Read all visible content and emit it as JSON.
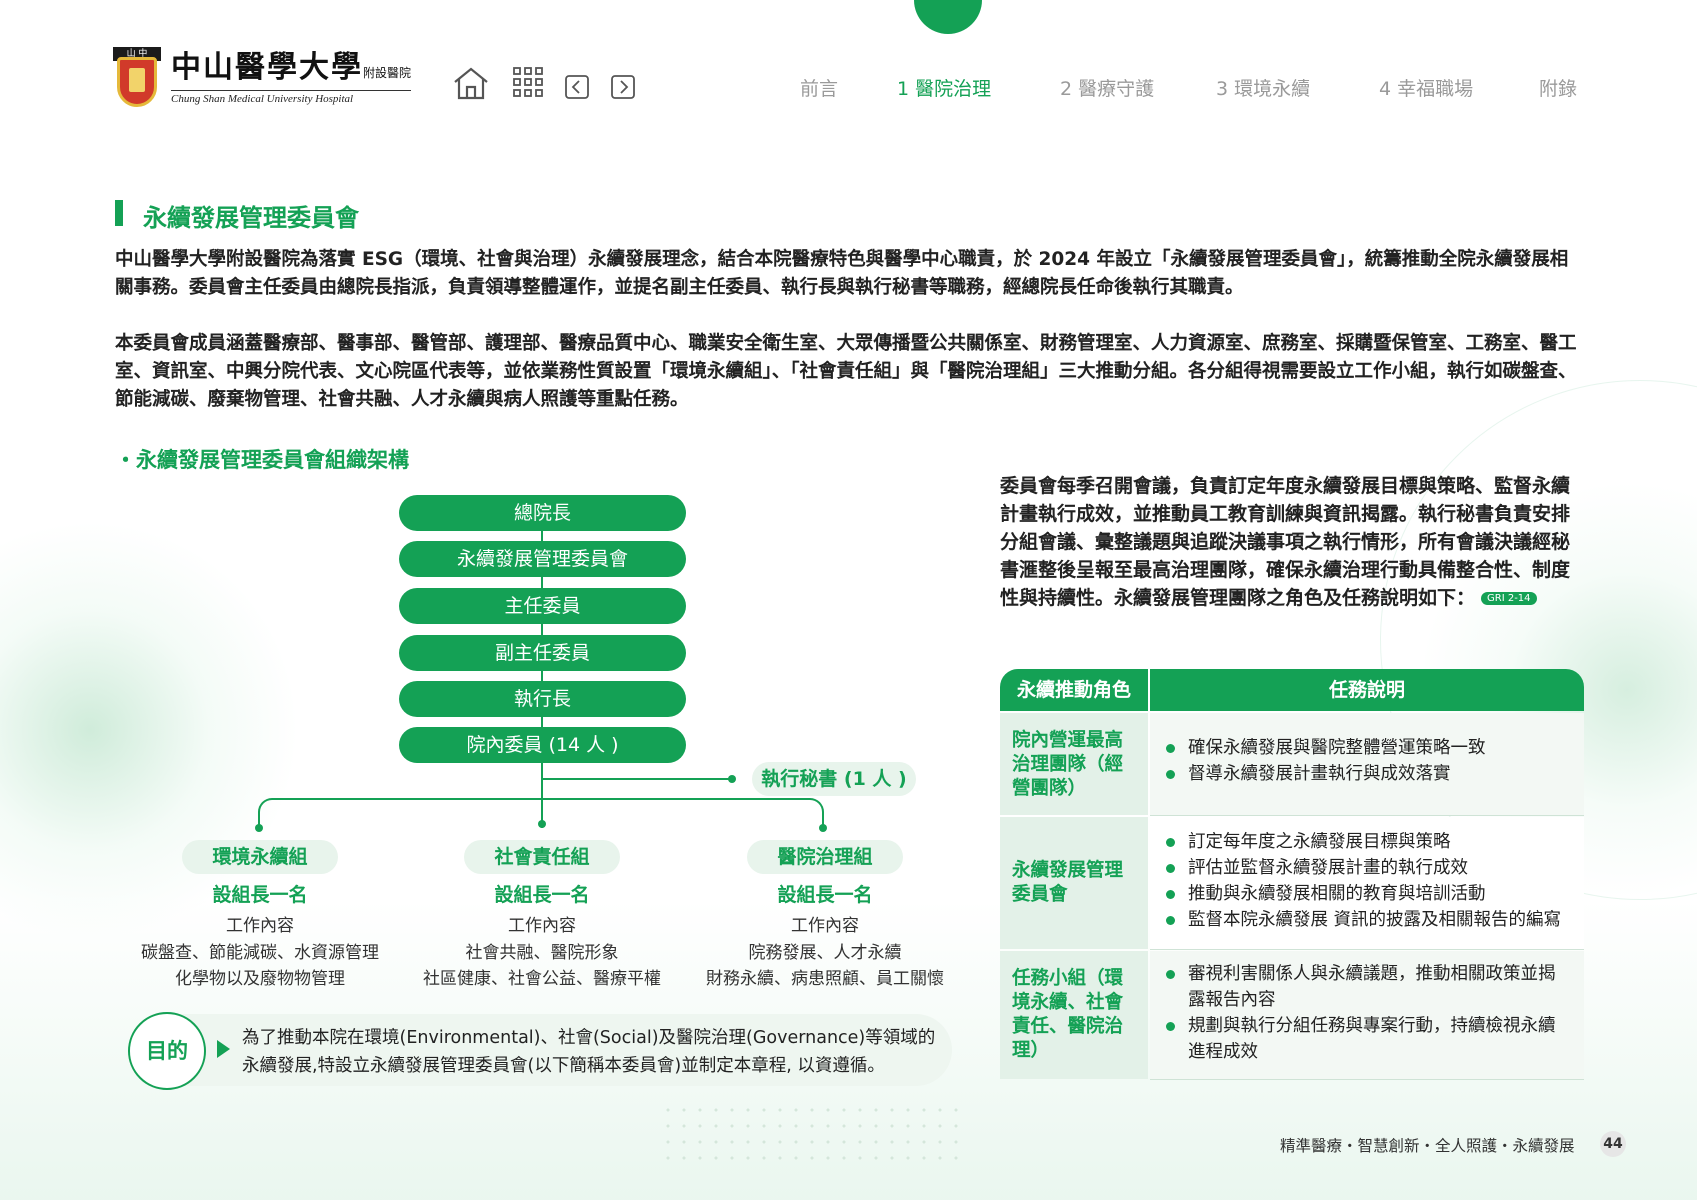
{
  "header": {
    "logo_cap": "山 中",
    "logo_cn": "中山醫學大學",
    "logo_cn_small": "附設醫院",
    "logo_en": "Chung Shan Medical University Hospital",
    "nav": [
      "前言",
      "1 醫院治理",
      "2 醫療守護",
      "3 環境永續",
      "4 幸福職場",
      "附錄"
    ],
    "active_nav": "1 醫院治理",
    "tool_icons": [
      "home-icon",
      "grid-icon",
      "chevron-left-icon",
      "chevron-right-icon"
    ]
  },
  "section": {
    "title": "永續發展管理委員會",
    "para1": "中山醫學大學附設醫院為落實 ESG（環境、社會與治理）永續發展理念，結合本院醫療特色與醫學中心職責，於 2024 年設立「永續發展管理委員會」，統籌推動全院永續發展相關事務。委員會主任委員由總院長指派，負責領導整體運作，並提名副主任委員、執行長與執行秘書等職務，經總院長任命後執行其職責。",
    "para2": "本委員會成員涵蓋醫療部、醫事部、醫管部、護理部、醫療品質中心、職業安全衛生室、大眾傳播暨公共關係室、財務管理室、人力資源室、庶務室、採購暨保管室、工務室、醫工室、資訊室、中興分院代表、文心院區代表等，並依業務性質設置「環境永續組」、「社會責任組」與「醫院治理組」三大推動分組。各分組得視需要設立工作小組，執行如碳盤查、節能減碳、廢棄物管理、社會共融、人才永續與病人照護等重點任務。",
    "org_title": "・永續發展管理委員會組織架構"
  },
  "org": {
    "levels": [
      "總院長",
      "永續發展管理委員會",
      "主任委員",
      "副主任委員",
      "執行長",
      "院內委員 (14 人 )"
    ],
    "secretary": "執行秘書 (1 人 )",
    "groups": [
      {
        "name": "環境永續組",
        "lead": "設組長一名",
        "work_label": "工作內容",
        "lines": [
          "碳盤查、節能減碳、水資源管理",
          "化學物以及廢物物管理"
        ]
      },
      {
        "name": "社會責任組",
        "lead": "設組長一名",
        "work_label": "工作內容",
        "lines": [
          "社會共融、醫院形象",
          "社區健康、社會公益、醫療平權"
        ]
      },
      {
        "name": "醫院治理組",
        "lead": "設組長一名",
        "work_label": "工作內容",
        "lines": [
          "院務發展、人才永續",
          "財務永續、病患照顧、員工關懷"
        ]
      }
    ]
  },
  "purpose": {
    "label": "目的",
    "text": "為了推動本院在環境(Environmental)、社會(Social)及醫院治理(Governance)等領域的永續發展,特設立永續發展管理委員會(以下簡稱本委員會)並制定本章程, 以資遵循。"
  },
  "right": {
    "para": "委員會每季召開會議，負責訂定年度永續發展目標與策略、監督永續計畫執行成效，並推動員工教育訓練與資訊揭露。執行秘書負責安排分組會議、彙整議題與追蹤決議事項之執行情形，所有會議決議經秘書滙整後呈報至最高治理團隊，確保永續治理行動具備整合性、制度性與持續性。永續發展管理團隊之角色及任務說明如下：",
    "gri": "GRI 2-14"
  },
  "table": {
    "headers": [
      "永續推動角色",
      "任務說明"
    ],
    "rows": [
      {
        "role": "院內營運最高治理團隊（經營團隊）",
        "tasks": [
          "確保永續發展與醫院整體營運策略一致",
          "督導永續發展計畫執行與成效落實"
        ]
      },
      {
        "role": "永續發展管理委員會",
        "tasks": [
          "訂定每年度之永續發展目標與策略",
          "評估並監督永續發展計畫的執行成效",
          "推動與永續發展相關的教育與培訓活動",
          "監督本院永續發展 資訊的披露及相關報告的編寫"
        ]
      },
      {
        "role": "任務小組（環境永續、社會責任、醫院治理）",
        "tasks": [
          "審視利害關係人與永續議題，推動相關政策並揭露報告內容",
          "規劃與執行分組任務與專案行動，持續檢視永續進程成效"
        ]
      }
    ]
  },
  "footer": {
    "slogan": "精準醫療・智慧創新・全人照護・永續發展",
    "page": "44"
  },
  "colors": {
    "brand_green": "#14a155",
    "light_green": "#e8f4ec"
  }
}
